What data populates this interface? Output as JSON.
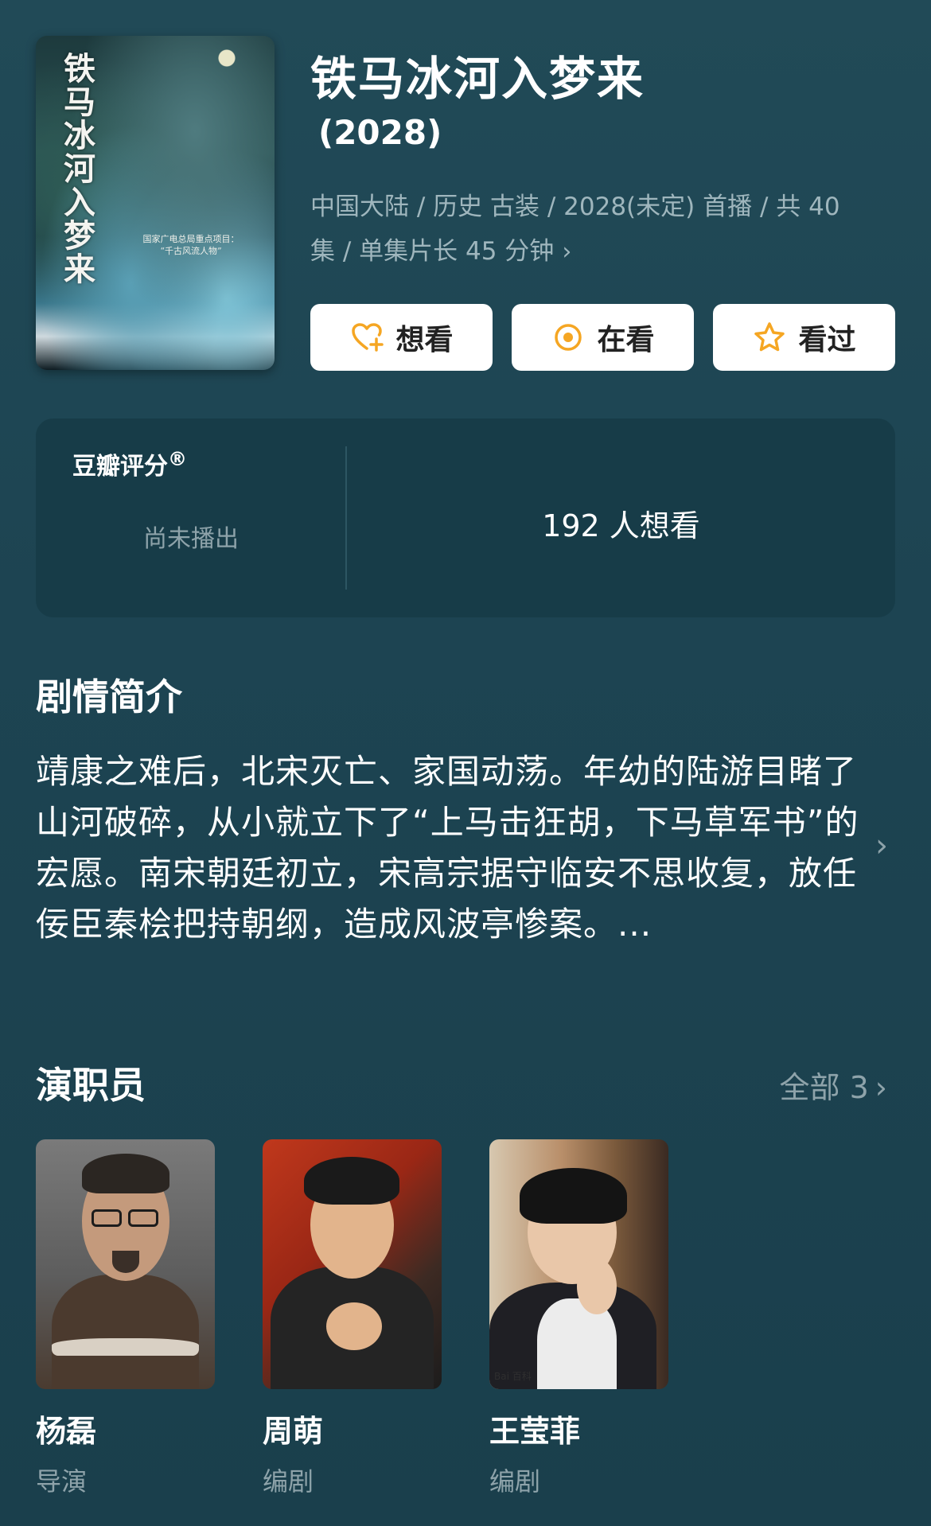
{
  "poster": {
    "title_text": "铁马冰河入梦来",
    "caption_line1": "国家广电总局重点项目：",
    "caption_line2": "“千古风流人物”"
  },
  "header": {
    "title": "铁马冰河入梦来",
    "year": "(2028)",
    "meta_line": "中国大陆 / 历史 古装 / 2028(未定) 首播 / 共 40 集 / 单集片长 45 分钟",
    "meta_chevron": "›"
  },
  "actions": {
    "want": "想看",
    "watching": "在看",
    "watched": "看过"
  },
  "rating": {
    "label": "豆瓣评分",
    "reg_mark": "®",
    "status": "尚未播出",
    "want_count": "192 人想看"
  },
  "synopsis": {
    "title": "剧情简介",
    "text": "靖康之难后，北宋灭亡、家国动荡。年幼的陆游目睹了山河破碎，从小就立下了“上马击狂胡，下马草军书”的宏愿。南宋朝廷初立，宋高宗据守临安不思收复，放任佞臣秦桧把持朝纲，造成风波亭惨案。...",
    "chevron": "›"
  },
  "cast": {
    "title": "演职员",
    "all_label": "全部 3",
    "all_chevron": "›",
    "members": [
      {
        "name": "杨磊",
        "role": "导演"
      },
      {
        "name": "周萌",
        "role": "编剧"
      },
      {
        "name": "王莹菲",
        "role": "编剧"
      }
    ],
    "watermark": "Bai 百科"
  },
  "colors": {
    "background": "#1e4652",
    "card": "#173c48",
    "muted_text": "#8ea3aa",
    "accent_orange": "#f5a623"
  }
}
